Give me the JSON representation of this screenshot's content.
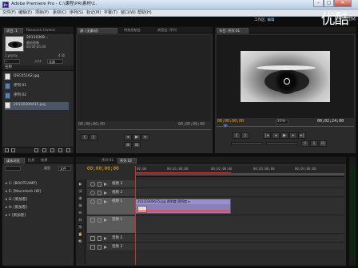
{
  "window": {
    "title": "Adobe Premiere Pro - C:\\课程\\PR\\素材\\1.",
    "app_icon": "Pr",
    "buttons": [
      "–",
      "▢",
      "✕"
    ]
  },
  "logo": {
    "text": "优酷",
    "suffix": "TM"
  },
  "menu": [
    "文件(F)",
    "编辑(E)",
    "项目(P)",
    "素材(C)",
    "序列(S)",
    "标记(M)",
    "字幕(T)",
    "窗口(W)",
    "帮助(H)"
  ],
  "workspace": {
    "label": "工作区:",
    "value": "编辑"
  },
  "project_panel": {
    "tabs": [
      "项目: 1",
      "Resource Central"
    ],
    "clip_name": "20110309...",
    "clip_info": [
      "静态图像",
      "00;00;05;00"
    ],
    "project_file": "1.prproj",
    "item_count": "4 项",
    "search_label": "入口:",
    "search_value": "全部",
    "column_name": "名称",
    "items": [
      {
        "label": "DSC05162.jpg",
        "type": "image"
      },
      {
        "label": "序列 01",
        "type": "sequence"
      },
      {
        "label": "序列 02",
        "type": "sequence"
      },
      {
        "label": "20110309415.jpg",
        "type": "image"
      }
    ]
  },
  "source_panel": {
    "tabs": [
      "源: (无素材)",
      "特效控制台",
      "调音台: 序列"
    ],
    "timecode": "00;00;00;00",
    "end_timecode": "00;00;00;00"
  },
  "program_panel": {
    "tabs": [
      "节目: 序列 01"
    ],
    "timecode_in": "00;00;00;00",
    "zoom": "25%",
    "timecode_duration": "00;02;24;00"
  },
  "effects_panel": {
    "tabs": [
      "媒体浏览",
      "信息",
      "效果"
    ],
    "view_label": "类型",
    "view_value": "文件",
    "drives": [
      "C: [BOOTCAMP]",
      "E: [Macintosh HD]",
      "G: [新加卷]",
      "H: [新加卷]",
      "I: [新加卷]"
    ]
  },
  "timeline": {
    "tabs": [
      "序列 01",
      "序列 02"
    ],
    "timecode": "00;00;00;00",
    "ruler_labels": [
      "00;00",
      "00;01;00;00",
      "00;02;00;00",
      "00;03;00;00",
      "00;04;00;00"
    ],
    "video_tracks": [
      "视频 3",
      "视频 2",
      "视频 1"
    ],
    "audio_tracks": [
      "音频 1",
      "音频 2",
      "音频 3"
    ],
    "clip_label": "20110309415.jpg  透明度:透明度 ▾"
  },
  "tools": [
    "▶",
    "⇥",
    "✥",
    "⊞",
    "✂",
    "↔",
    "✎",
    "✋",
    "🔍"
  ]
}
